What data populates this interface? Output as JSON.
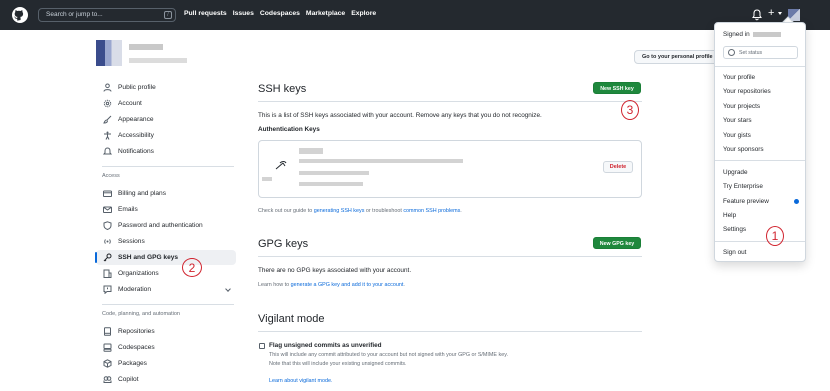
{
  "header": {
    "search_placeholder": "Search or jump to...",
    "search_shortcut": "/",
    "nav": [
      "Pull requests",
      "Issues",
      "Codespaces",
      "Marketplace",
      "Explore"
    ],
    "plus_label": "+"
  },
  "profile": {
    "go_to_profile_button": "Go to your personal profile"
  },
  "sidebar": {
    "items_top": [
      {
        "label": "Public profile",
        "icon": "person-icon"
      },
      {
        "label": "Account",
        "icon": "gear-icon"
      },
      {
        "label": "Appearance",
        "icon": "paintbrush-icon"
      },
      {
        "label": "Accessibility",
        "icon": "accessibility-icon"
      },
      {
        "label": "Notifications",
        "icon": "bell-icon"
      }
    ],
    "access_heading": "Access",
    "items_access": [
      {
        "label": "Billing and plans",
        "icon": "credit-card-icon"
      },
      {
        "label": "Emails",
        "icon": "mail-icon"
      },
      {
        "label": "Password and authentication",
        "icon": "shield-lock-icon"
      },
      {
        "label": "Sessions",
        "icon": "broadcast-icon"
      },
      {
        "label": "SSH and GPG keys",
        "icon": "key-icon",
        "active": true
      },
      {
        "label": "Organizations",
        "icon": "organization-icon"
      },
      {
        "label": "Moderation",
        "icon": "report-icon"
      }
    ],
    "code_heading": "Code, planning, and automation",
    "items_code": [
      {
        "label": "Repositories",
        "icon": "repo-icon"
      },
      {
        "label": "Codespaces",
        "icon": "codespaces-icon"
      },
      {
        "label": "Packages",
        "icon": "package-icon"
      },
      {
        "label": "Copilot",
        "icon": "copilot-icon"
      }
    ]
  },
  "ssh": {
    "title": "SSH keys",
    "new_button": "New SSH key",
    "description": "This is a list of SSH keys associated with your account. Remove any keys that you do not recognize.",
    "auth_heading": "Authentication Keys",
    "delete_button": "Delete",
    "guide_prefix": "Check out our guide to ",
    "guide_link1": "generating SSH keys",
    "guide_middle": " or troubleshoot ",
    "guide_link2": "common SSH problems",
    "guide_suffix": "."
  },
  "gpg": {
    "title": "GPG keys",
    "new_button": "New GPG key",
    "empty": "There are no GPG keys associated with your account.",
    "learn_prefix": "Learn how to ",
    "learn_link": "generate a GPG key and add it to your account",
    "learn_suffix": "."
  },
  "vigilant": {
    "title": "Vigilant mode",
    "flag_label": "Flag unsigned commits as unverified",
    "desc1": "This will include any commit attributed to your account but not signed with your GPG or S/MIME key.",
    "desc2": "Note that this will include your existing unsigned commits.",
    "learn_link": "Learn about vigilant mode."
  },
  "dropdown": {
    "signed_in": "Signed in",
    "set_status": "Set status",
    "group1": [
      "Your profile",
      "Your repositories",
      "Your projects",
      "Your stars",
      "Your gists",
      "Your sponsors"
    ],
    "group2": [
      "Upgrade",
      "Try Enterprise",
      "Feature preview",
      "Help",
      "Settings"
    ],
    "sign_out": "Sign out"
  },
  "annotations": {
    "one": "1",
    "two": "2",
    "three": "3"
  },
  "colors": {
    "header_bg": "#24292f",
    "primary_button": "#1f883d",
    "link": "#0969da",
    "danger": "#cf222e",
    "annotation": "#d1242f"
  }
}
